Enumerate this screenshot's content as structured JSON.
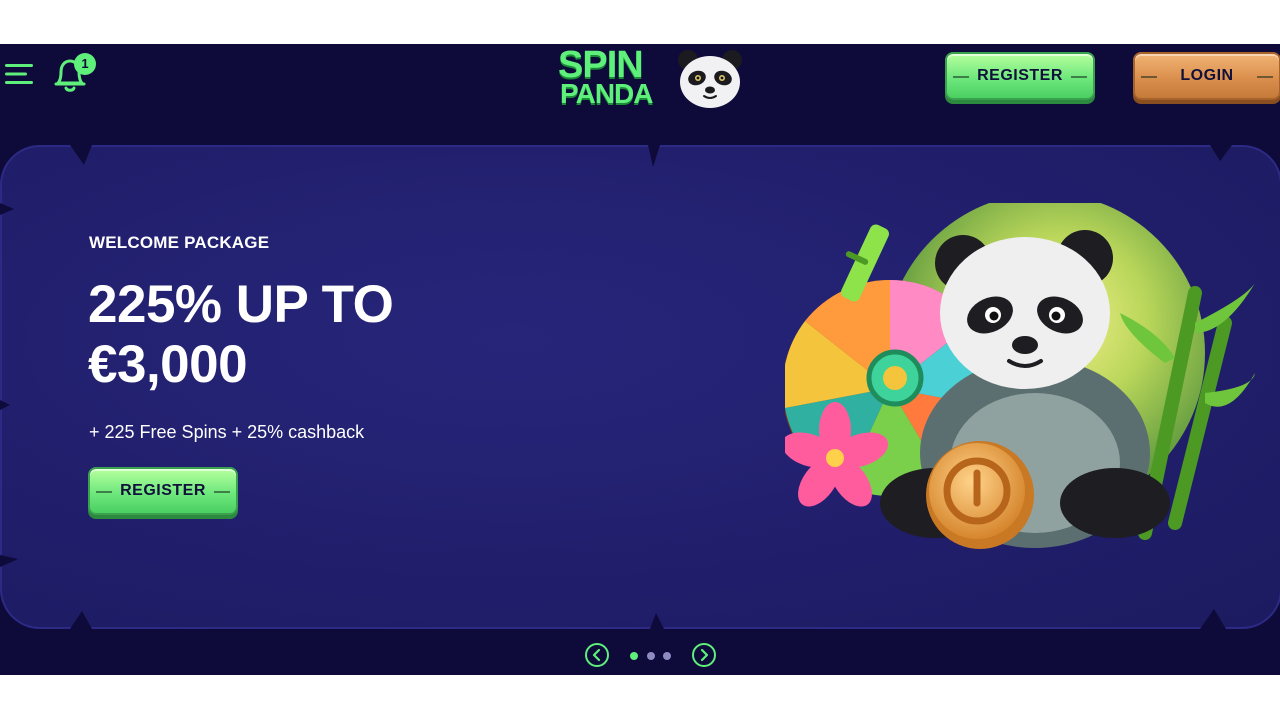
{
  "header": {
    "notification_count": "1",
    "logo": {
      "line1": "SPIN",
      "line2": "PANDA"
    },
    "register_label": "REGISTER",
    "login_label": "LOGIN"
  },
  "hero": {
    "eyebrow": "WELCOME PACKAGE",
    "title": "225% UP TO €3,000",
    "subtitle": "+ 225 Free Spins + 25% cashback",
    "register_label": "REGISTER"
  },
  "carousel": {
    "slide_count": 3,
    "active_index": 0
  },
  "colors": {
    "page_bg": "#0e0a3a",
    "hero_bg": "#221f6e",
    "accent_green": "#5ef07a",
    "button_orange": "#db8f4d",
    "text_dark": "#10113a"
  },
  "icons": {
    "menu": "hamburger-menu-icon",
    "notifications": "bell-icon",
    "prev": "chevron-left-icon",
    "next": "chevron-right-icon"
  }
}
